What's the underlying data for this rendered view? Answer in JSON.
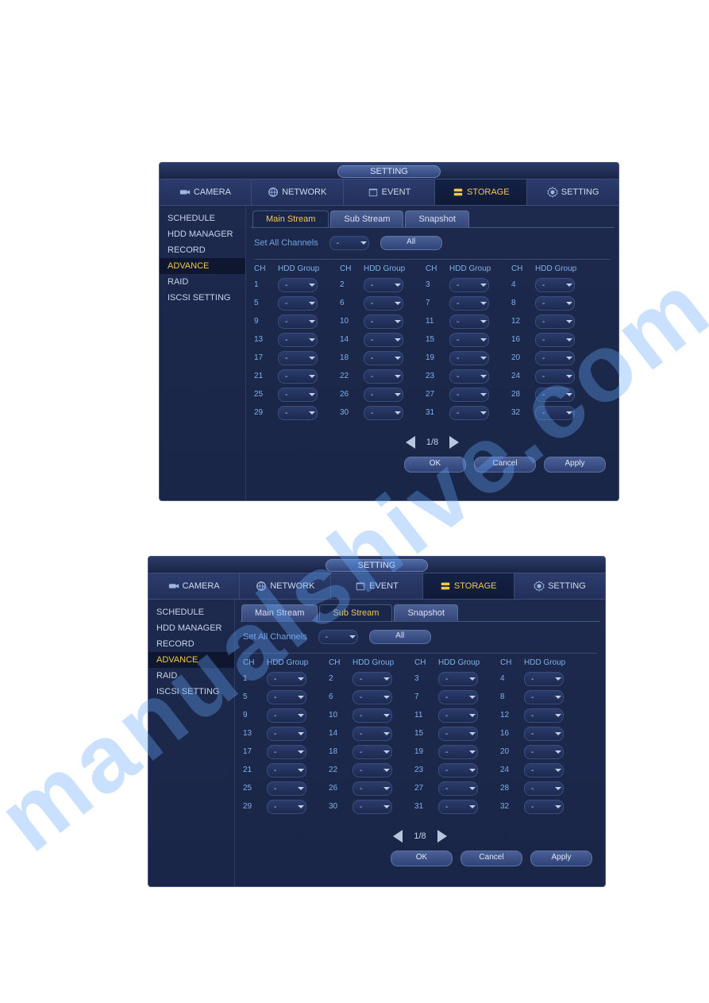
{
  "watermark": "manualshive.com",
  "panels": [
    {
      "title": "SETTING",
      "topnav": [
        {
          "label": "CAMERA",
          "icon": "camera-icon",
          "active": false
        },
        {
          "label": "NETWORK",
          "icon": "network-icon",
          "active": false
        },
        {
          "label": "EVENT",
          "icon": "event-icon",
          "active": false
        },
        {
          "label": "STORAGE",
          "icon": "storage-icon",
          "active": true
        },
        {
          "label": "SETTING",
          "icon": "setting-icon",
          "active": false
        }
      ],
      "sidebar": [
        {
          "label": "SCHEDULE",
          "active": false
        },
        {
          "label": "HDD MANAGER",
          "active": false
        },
        {
          "label": "RECORD",
          "active": false
        },
        {
          "label": "ADVANCE",
          "active": true
        },
        {
          "label": "RAID",
          "active": false
        },
        {
          "label": "ISCSI SETTING",
          "active": false
        }
      ],
      "subtabs": [
        {
          "label": "Main Stream",
          "active": true
        },
        {
          "label": "Sub Stream",
          "active": false
        },
        {
          "label": "Snapshot",
          "active": false
        }
      ],
      "setall": {
        "label": "Set All Channels",
        "value": "-",
        "all_btn": "All"
      },
      "grid_head": {
        "ch": "CH",
        "hg": "HDD Group"
      },
      "channels": [
        1,
        2,
        3,
        4,
        5,
        6,
        7,
        8,
        9,
        10,
        11,
        12,
        13,
        14,
        15,
        16,
        17,
        18,
        19,
        20,
        21,
        22,
        23,
        24,
        25,
        26,
        27,
        28,
        29,
        30,
        31,
        32
      ],
      "channel_value": "-",
      "pager": {
        "page": "1/8"
      },
      "buttons": {
        "ok": "OK",
        "cancel": "Cancel",
        "apply": "Apply"
      }
    },
    {
      "title": "SETTING",
      "topnav": [
        {
          "label": "CAMERA",
          "icon": "camera-icon",
          "active": false
        },
        {
          "label": "NETWORK",
          "icon": "network-icon",
          "active": false
        },
        {
          "label": "EVENT",
          "icon": "event-icon",
          "active": false
        },
        {
          "label": "STORAGE",
          "icon": "storage-icon",
          "active": true
        },
        {
          "label": "SETTING",
          "icon": "setting-icon",
          "active": false
        }
      ],
      "sidebar": [
        {
          "label": "SCHEDULE",
          "active": false
        },
        {
          "label": "HDD MANAGER",
          "active": false
        },
        {
          "label": "RECORD",
          "active": false
        },
        {
          "label": "ADVANCE",
          "active": true
        },
        {
          "label": "RAID",
          "active": false
        },
        {
          "label": "ISCSI SETTING",
          "active": false
        }
      ],
      "subtabs": [
        {
          "label": "Main Stream",
          "active": false
        },
        {
          "label": "Sub Stream",
          "active": true
        },
        {
          "label": "Snapshot",
          "active": false
        }
      ],
      "setall": {
        "label": "Set All Channels",
        "value": "-",
        "all_btn": "All"
      },
      "grid_head": {
        "ch": "CH",
        "hg": "HDD Group"
      },
      "channels": [
        1,
        2,
        3,
        4,
        5,
        6,
        7,
        8,
        9,
        10,
        11,
        12,
        13,
        14,
        15,
        16,
        17,
        18,
        19,
        20,
        21,
        22,
        23,
        24,
        25,
        26,
        27,
        28,
        29,
        30,
        31,
        32
      ],
      "channel_value": "-",
      "pager": {
        "page": "1/8"
      },
      "buttons": {
        "ok": "OK",
        "cancel": "Cancel",
        "apply": "Apply"
      }
    }
  ]
}
